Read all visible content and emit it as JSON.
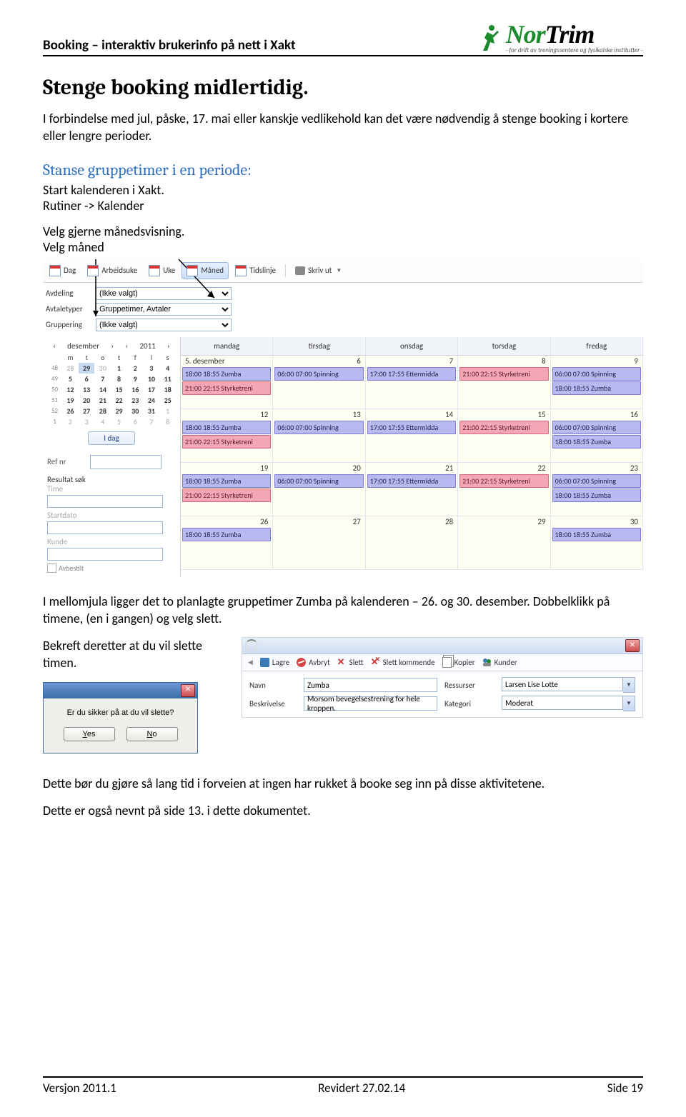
{
  "header": {
    "title": "Booking – interaktiv brukerinfo på nett i Xakt"
  },
  "logo": {
    "line1a": "Nor",
    "line1b": "Trim",
    "tagline": "- for drift av treningssentere og fysikalske institutter -"
  },
  "h1": "Stenge booking midlertidig.",
  "p1": "I forbindelse med jul, påske, 17. mai eller kanskje vedlikehold kan det være nødvendig å stenge booking i kortere eller lengre perioder.",
  "h2": "Stanse gruppetimer i en periode:",
  "p2a": "Start kalenderen i Xakt.",
  "p2b": "Rutiner -> Kalender",
  "p3": "Velg gjerne månedsvisning.",
  "p4": "Velg måned",
  "toolbar": {
    "dag": "Dag",
    "arbeidsuke": "Arbeidsuke",
    "uke": "Uke",
    "maned": "Måned",
    "tidslinje": "Tidslinje",
    "skriv_ut": "Skriv ut"
  },
  "filters": {
    "avdeling_label": "Avdeling",
    "avdeling_val": "(Ikke valgt)",
    "avtaletyper_label": "Avtaletyper",
    "avtaletyper_val": "Gruppetimer, Avtaler",
    "gruppering_label": "Gruppering",
    "gruppering_val": "(Ikke valgt)"
  },
  "minical": {
    "month": "desember",
    "year": "2011",
    "dow": [
      "m",
      "t",
      "o",
      "t",
      "f",
      "l",
      "s"
    ],
    "rows": [
      {
        "wk": "48",
        "d": [
          "28",
          "29",
          "30",
          "1",
          "2",
          "3",
          "4"
        ],
        "grey": [
          0,
          2
        ]
      },
      {
        "wk": "49",
        "d": [
          "5",
          "6",
          "7",
          "8",
          "9",
          "10",
          "11"
        ]
      },
      {
        "wk": "50",
        "d": [
          "12",
          "13",
          "14",
          "15",
          "16",
          "17",
          "18"
        ]
      },
      {
        "wk": "51",
        "d": [
          "19",
          "20",
          "21",
          "22",
          "23",
          "24",
          "25"
        ]
      },
      {
        "wk": "52",
        "d": [
          "26",
          "27",
          "28",
          "29",
          "30",
          "31",
          "1"
        ],
        "grey": [
          6
        ]
      },
      {
        "wk": "1",
        "d": [
          "2",
          "3",
          "4",
          "5",
          "6",
          "7",
          "8"
        ],
        "grey": [
          0,
          1,
          2,
          3,
          4,
          5,
          6
        ]
      }
    ],
    "today_row": 0,
    "today_col": 1,
    "idag": "I dag"
  },
  "ref": {
    "refnr": "Ref nr",
    "resultat": "Resultat søk",
    "time": "Time",
    "startdato": "Startdato",
    "kunde": "Kunde",
    "avbestilt": "Avbestilt"
  },
  "grid": {
    "headers": [
      "mandag",
      "tirsdag",
      "onsdag",
      "torsdag",
      "fredag"
    ],
    "weeks": [
      {
        "first": "5. desember",
        "days": [
          "5",
          "6",
          "7",
          "8",
          "9"
        ],
        "cells": [
          [
            {
              "t": "18:00 18:55 Zumba",
              "c": "violet"
            },
            {
              "t": "21:00 22:15 Styrketreni",
              "c": "pink"
            }
          ],
          [
            {
              "t": "06:00 07:00 Spinning",
              "c": "violet"
            }
          ],
          [
            {
              "t": "17:00 17:55 Ettermidda",
              "c": "violet"
            }
          ],
          [
            {
              "t": "21:00 22:15 Styrketreni",
              "c": "pink"
            }
          ],
          [
            {
              "t": "06:00 07:00 Spinning",
              "c": "violet"
            },
            {
              "t": "18:00 18:55 Zumba",
              "c": "violet"
            }
          ]
        ]
      },
      {
        "first": "",
        "days": [
          "12",
          "13",
          "14",
          "15",
          "16"
        ],
        "cells": [
          [
            {
              "t": "18:00 18:55 Zumba",
              "c": "violet"
            },
            {
              "t": "21:00 22:15 Styrketreni",
              "c": "pink"
            }
          ],
          [
            {
              "t": "06:00 07:00 Spinning",
              "c": "violet"
            }
          ],
          [
            {
              "t": "17:00 17:55 Ettermidda",
              "c": "violet"
            }
          ],
          [
            {
              "t": "21:00 22:15 Styrketreni",
              "c": "pink"
            }
          ],
          [
            {
              "t": "06:00 07:00 Spinning",
              "c": "violet"
            },
            {
              "t": "18:00 18:55 Zumba",
              "c": "violet"
            }
          ]
        ]
      },
      {
        "first": "",
        "days": [
          "19",
          "20",
          "21",
          "22",
          "23"
        ],
        "cells": [
          [
            {
              "t": "18:00 18:55 Zumba",
              "c": "violet"
            },
            {
              "t": "21:00 22:15 Styrketreni",
              "c": "pink"
            }
          ],
          [
            {
              "t": "06:00 07:00 Spinning",
              "c": "violet"
            }
          ],
          [
            {
              "t": "17:00 17:55 Ettermidda",
              "c": "violet"
            }
          ],
          [
            {
              "t": "21:00 22:15 Styrketreni",
              "c": "pink"
            }
          ],
          [
            {
              "t": "06:00 07:00 Spinning",
              "c": "violet"
            },
            {
              "t": "18:00 18:55 Zumba",
              "c": "violet"
            }
          ]
        ]
      },
      {
        "first": "",
        "days": [
          "26",
          "27",
          "28",
          "29",
          "30"
        ],
        "cells": [
          [
            {
              "t": "18:00 18:55 Zumba",
              "c": "violet"
            }
          ],
          [],
          [],
          [],
          [
            {
              "t": "18:00 18:55 Zumba",
              "c": "violet"
            }
          ]
        ]
      }
    ]
  },
  "p5": "I mellomjula ligger det to planlagte gruppetimer Zumba på kalenderen – 26. og 30. desember. Dobbelklikk på timene, (en i gangen) og velg slett.",
  "p6": "Bekreft deretter at du vil slette timen.",
  "dialog": {
    "msg": "Er du sikker på at du vil slette?",
    "yes": "Yes",
    "no": "No"
  },
  "editbar": {
    "lagre": "Lagre",
    "avbryt": "Avbryt",
    "slett": "Slett",
    "slett_kommende": "Slett kommende",
    "kopier": "Kopier",
    "kunder": "Kunder"
  },
  "form": {
    "navn_l": "Navn",
    "navn_v": "Zumba",
    "besk_l": "Beskrivelse",
    "besk_v": "Morsom bevegelsestrening for hele kroppen.",
    "ress_l": "Ressurser",
    "ress_v": "Larsen Lise Lotte",
    "kat_l": "Kategori",
    "kat_v": "Moderat"
  },
  "p7": "Dette bør du gjøre så lang tid i forveien at ingen har rukket å booke seg inn på disse aktivitetene.",
  "p8": "Dette er også nevnt på side 13. i dette dokumentet.",
  "footer": {
    "left": "Versjon 2011.1",
    "center": "Revidert 27.02.14",
    "right": "Side 19"
  }
}
